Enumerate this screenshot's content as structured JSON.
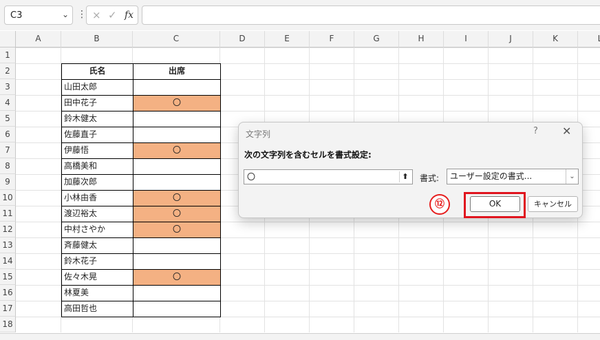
{
  "formula_bar": {
    "name_box": "C3",
    "fx": "fx",
    "cancel_glyph": "×",
    "enter_glyph": "✓",
    "content": ""
  },
  "columns": [
    "A",
    "B",
    "C",
    "D",
    "E",
    "F",
    "G",
    "H",
    "I",
    "J",
    "K",
    "L"
  ],
  "rows": [
    "1",
    "2",
    "3",
    "4",
    "5",
    "6",
    "7",
    "8",
    "9",
    "10",
    "11",
    "12",
    "13",
    "14",
    "15",
    "16",
    "17",
    "18"
  ],
  "table": {
    "header_name": "氏名",
    "header_attend": "出席",
    "records": [
      {
        "name": "山田太郎",
        "mark": "",
        "hl": false
      },
      {
        "name": "田中花子",
        "mark": "〇",
        "hl": true
      },
      {
        "name": "鈴木健太",
        "mark": "",
        "hl": false
      },
      {
        "name": "佐藤直子",
        "mark": "",
        "hl": false
      },
      {
        "name": "伊藤悟",
        "mark": "〇",
        "hl": true
      },
      {
        "name": "高橋美和",
        "mark": "",
        "hl": false
      },
      {
        "name": "加藤次郎",
        "mark": "",
        "hl": false
      },
      {
        "name": "小林由香",
        "mark": "〇",
        "hl": true
      },
      {
        "name": "渡辺裕太",
        "mark": "〇",
        "hl": true
      },
      {
        "name": "中村さやか",
        "mark": "〇",
        "hl": true
      },
      {
        "name": "斉藤健太",
        "mark": "",
        "hl": false
      },
      {
        "name": "鈴木花子",
        "mark": "",
        "hl": false
      },
      {
        "name": "佐々木晃",
        "mark": "〇",
        "hl": true
      },
      {
        "name": "林夏美",
        "mark": "",
        "hl": false
      },
      {
        "name": "高田哲也",
        "mark": "",
        "hl": false
      }
    ],
    "highlight_color": "#f4b183"
  },
  "dialog": {
    "title": "文字列",
    "help": "?",
    "close": "✕",
    "instruction": "次の文字列を含むセルを書式設定:",
    "input_value": "〇",
    "format_label": "書式:",
    "format_value": "ユーザー設定の書式...",
    "step_badge": "⑫",
    "ok_label": "OK",
    "cancel_label": "キャンセル",
    "annotation_color": "#e0141e"
  }
}
